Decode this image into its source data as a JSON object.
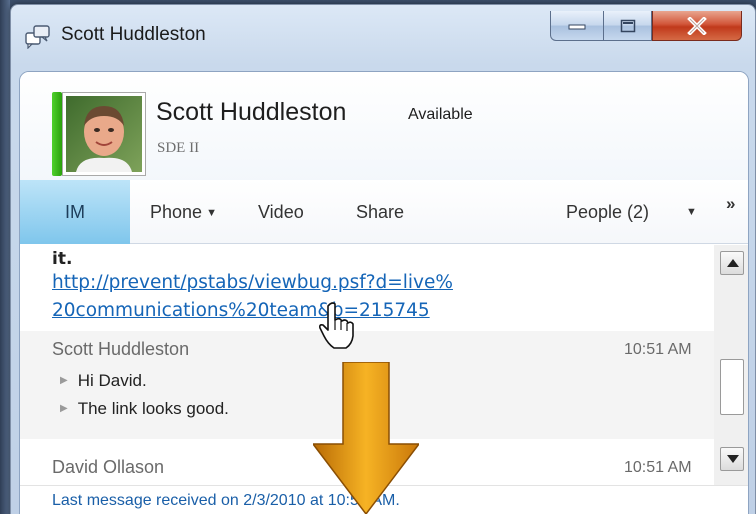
{
  "window": {
    "title": "Scott Huddleston",
    "controls": {
      "minimize": "minimize",
      "maximize": "maximize",
      "close": "close"
    }
  },
  "contact": {
    "name": "Scott Huddleston",
    "status": "Available",
    "title": "SDE II",
    "presence_color": "#3cc21b"
  },
  "tabs": {
    "im": "IM",
    "phone": "Phone",
    "video": "Video",
    "share": "Share",
    "people": "People (2)",
    "overflow": "»"
  },
  "conversation": {
    "previous_fragment": "it.",
    "link_line_1": "http://prevent/pstabs/viewbug.psf?d=live%",
    "link_line_2": "20communications%20team&b=215745",
    "messages": [
      {
        "sender": "Scott Huddleston",
        "time": "10:51 AM",
        "lines": [
          "Hi David.",
          "The link looks good."
        ]
      },
      {
        "sender": "David Ollason",
        "time": "10:51 AM"
      }
    ]
  },
  "status_bar": {
    "text": "Last message received on 2/3/2010 at 10:51 AM."
  },
  "colors": {
    "accent_tab": "#7fc6ec",
    "link": "#1565b7",
    "arrow": "#e79a0c"
  }
}
